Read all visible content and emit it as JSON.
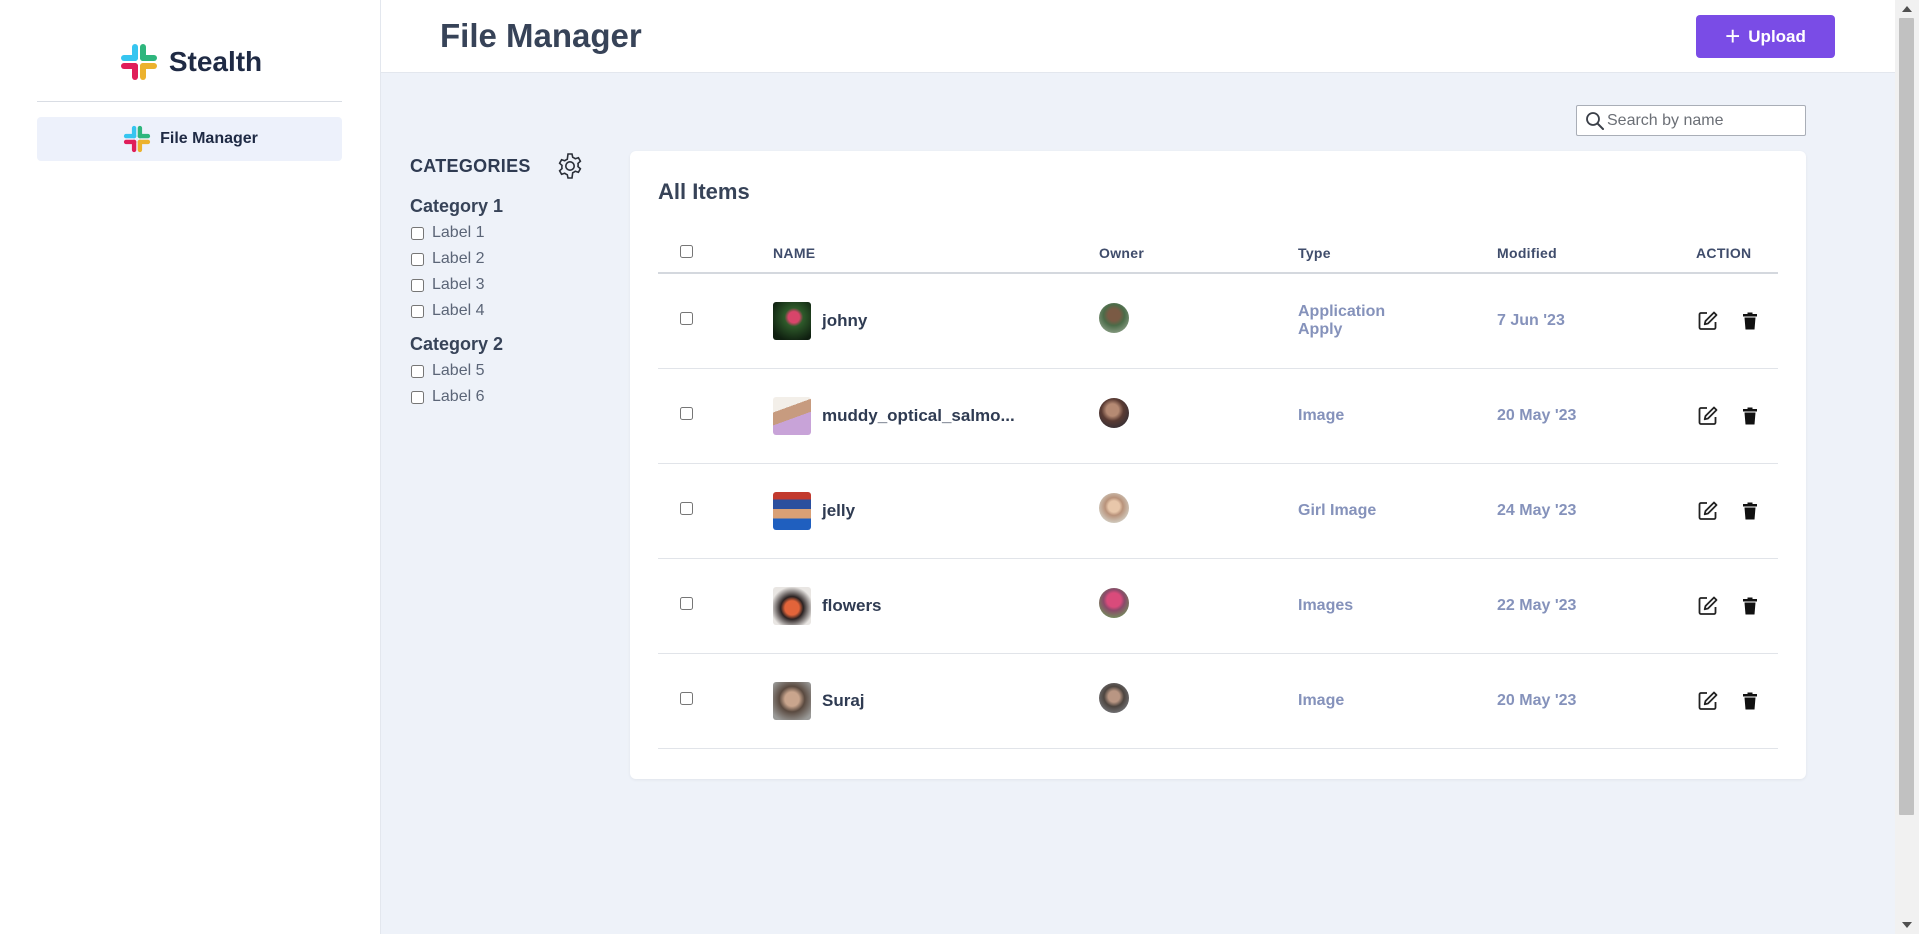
{
  "brand": {
    "name": "Stealth"
  },
  "sidebar": {
    "items": [
      {
        "label": "File Manager"
      }
    ]
  },
  "header": {
    "title": "File Manager",
    "upload_label": "Upload"
  },
  "search": {
    "placeholder": "Search by name",
    "value": ""
  },
  "categories": {
    "title": "CATEGORIES",
    "groups": [
      {
        "title": "Category 1",
        "labels": [
          "Label 1",
          "Label 2",
          "Label 3",
          "Label 4"
        ]
      },
      {
        "title": "Category 2",
        "labels": [
          "Label 5",
          "Label 6"
        ]
      }
    ]
  },
  "items_panel": {
    "title": "All Items",
    "columns": {
      "name": "NAME",
      "owner": "Owner",
      "type": "Type",
      "modified": "Modified",
      "action": "ACTION"
    },
    "rows": [
      {
        "name": "johny",
        "type": "Application Apply",
        "modified": "7 Jun '23"
      },
      {
        "name": "muddy_optical_salmo...",
        "type": "Image",
        "modified": "20 May '23"
      },
      {
        "name": "jelly",
        "type": "Girl Image",
        "modified": "24 May '23"
      },
      {
        "name": "flowers",
        "type": "Images",
        "modified": "22 May '23"
      },
      {
        "name": "Suraj",
        "type": "Image",
        "modified": "20 May '23"
      }
    ]
  },
  "colors": {
    "accent": "#7a4ce6",
    "sidebar_active": "#edf1fb",
    "page_bg": "#eef2f9",
    "muted_text": "#8592bb"
  },
  "icons": [
    "stealth-logo-icon",
    "search-icon",
    "gear-icon",
    "plus-icon",
    "edit-icon",
    "trash-icon"
  ]
}
